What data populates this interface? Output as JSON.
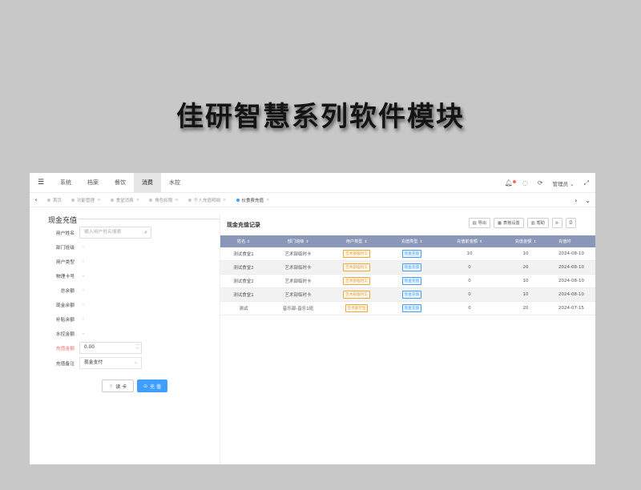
{
  "banner": {
    "title": "佳研智慧系列软件模块"
  },
  "topnav": {
    "items": [
      {
        "label": "系统",
        "active": false
      },
      {
        "label": "档案",
        "active": false
      },
      {
        "label": "餐饮",
        "active": false
      },
      {
        "label": "消费",
        "active": true
      },
      {
        "label": "水控",
        "active": false
      }
    ],
    "user": "管理员",
    "icons": [
      "menu-icon",
      "bell-icon",
      "chat-icon",
      "refresh-icon",
      "user-chevron-icon",
      "fullscreen-icon"
    ]
  },
  "tabs": [
    {
      "label": "首页",
      "active": false
    },
    {
      "label": "功能管理",
      "active": false
    },
    {
      "label": "食堂消费",
      "active": false
    },
    {
      "label": "角色权限",
      "active": false
    },
    {
      "label": "个人充值明细",
      "active": false
    },
    {
      "label": "伙食费充值",
      "active": true
    }
  ],
  "form": {
    "title": "现金充值",
    "username_label": "用户姓名",
    "username_placeholder": "输入用户姓名搜索",
    "dept_label": "部门班级",
    "dept_value": "-",
    "usertype_label": "用户类型",
    "usertype_value": "-",
    "cardno_label": "物理卡号",
    "cardno_value": "-",
    "total_label": "总余额",
    "total_value": "-",
    "cash_label": "现金余额",
    "cash_value": "-",
    "subsidy_label": "补贴余额",
    "subsidy_value": "-",
    "water_label": "水控金额",
    "water_value": "-",
    "amount_label": "充值金额",
    "amount_value": "0.00",
    "remark_label": "充值备注",
    "remark_value": "现金支付",
    "read_card": "读 卡",
    "charge": "充 值"
  },
  "records": {
    "title": "现金充值记录",
    "toolbar": [
      "导出",
      "表格设置",
      "帮助"
    ],
    "columns": [
      "姓名",
      "部门班级",
      "用户类型",
      "充值类型",
      "充值前金额",
      "充值金额",
      "充值时"
    ],
    "rows": [
      {
        "name": "测试食堂1",
        "dept": "艺术部临时卡",
        "usertype": "艺术部临时工",
        "chargetype": "现金充值",
        "before": "10",
        "amount": "10",
        "time": "2024-08-10"
      },
      {
        "name": "测试食堂2",
        "dept": "艺术部临时卡",
        "usertype": "艺术部临时工",
        "chargetype": "现金充值",
        "before": "0",
        "amount": "20",
        "time": "2024-08-10"
      },
      {
        "name": "测试食堂2",
        "dept": "艺术部临时卡",
        "usertype": "艺术部临时工",
        "chargetype": "现金充值",
        "before": "0",
        "amount": "10",
        "time": "2024-08-10"
      },
      {
        "name": "测试食堂1",
        "dept": "艺术部临时卡",
        "usertype": "艺术部临时工",
        "chargetype": "现金充值",
        "before": "0",
        "amount": "10",
        "time": "2024-08-10"
      },
      {
        "name": "测试",
        "dept": "音乐部-音乐1班",
        "usertype": "艺术部学生",
        "chargetype": "现金充值",
        "before": "0",
        "amount": "20",
        "time": "2024-07-15"
      }
    ]
  },
  "colors": {
    "accent": "#409eff",
    "header": "#8b97b8",
    "warn": "#e6a23c",
    "danger": "#f56c6c"
  }
}
